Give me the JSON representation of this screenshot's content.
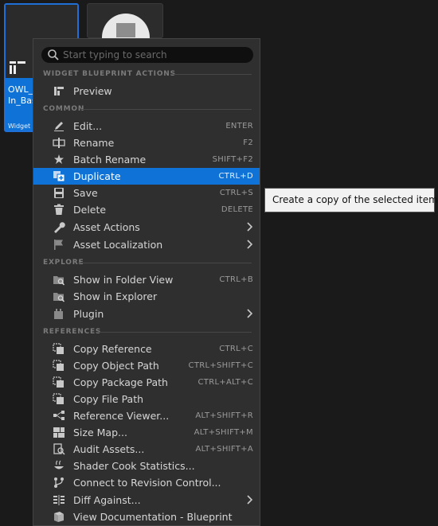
{
  "assets": [
    {
      "name_line1": "OWL_",
      "name_line2": "In_Bas",
      "type": "Widget B",
      "selected": true
    },
    {
      "name_line1": "",
      "name_line2": "",
      "type": "",
      "selected": false
    }
  ],
  "menu": {
    "search_placeholder": "Start typing to search",
    "sections": {
      "widget_actions": "WIDGET BLUEPRINT ACTIONS",
      "common": "COMMON",
      "explore": "EXPLORE",
      "references": "REFERENCES"
    },
    "items": [
      {
        "label": "Preview",
        "shortcut": "",
        "icon": "widget-blueprint-icon"
      },
      {
        "label": "Edit...",
        "shortcut": "ENTER",
        "icon": "pencil-icon"
      },
      {
        "label": "Rename",
        "shortcut": "F2",
        "icon": "rename-icon"
      },
      {
        "label": "Batch Rename",
        "shortcut": "SHIFT+F2",
        "icon": "batch-rename-icon"
      },
      {
        "label": "Duplicate",
        "shortcut": "CTRL+D",
        "icon": "duplicate-icon"
      },
      {
        "label": "Save",
        "shortcut": "CTRL+S",
        "icon": "save-icon"
      },
      {
        "label": "Delete",
        "shortcut": "DELETE",
        "icon": "trash-icon"
      },
      {
        "label": "Asset Actions",
        "shortcut": "",
        "icon": "wrench-icon"
      },
      {
        "label": "Asset Localization",
        "shortcut": "",
        "icon": "flag-icon"
      },
      {
        "label": "Show in Folder View",
        "shortcut": "CTRL+B",
        "icon": "folder-search-icon"
      },
      {
        "label": "Show in Explorer",
        "shortcut": "",
        "icon": "folder-icon"
      },
      {
        "label": "Plugin",
        "shortcut": "",
        "icon": "plugin-icon"
      },
      {
        "label": "Copy Reference",
        "shortcut": "CTRL+C",
        "icon": "copy-icon"
      },
      {
        "label": "Copy Object Path",
        "shortcut": "CTRL+SHIFT+C",
        "icon": "copy-icon"
      },
      {
        "label": "Copy Package Path",
        "shortcut": "CTRL+ALT+C",
        "icon": "copy-icon"
      },
      {
        "label": "Copy File Path",
        "shortcut": "",
        "icon": "copy-icon"
      },
      {
        "label": "Reference Viewer...",
        "shortcut": "ALT+SHIFT+R",
        "icon": "reference-viewer-icon"
      },
      {
        "label": "Size Map...",
        "shortcut": "ALT+SHIFT+M",
        "icon": "size-map-icon"
      },
      {
        "label": "Audit Assets...",
        "shortcut": "ALT+SHIFT+A",
        "icon": "audit-icon"
      },
      {
        "label": "Shader Cook Statistics...",
        "shortcut": "",
        "icon": "shader-icon"
      },
      {
        "label": "Connect to Revision Control...",
        "shortcut": "",
        "icon": "revision-control-icon"
      },
      {
        "label": "Diff Against...",
        "shortcut": "",
        "icon": "diff-icon"
      },
      {
        "label": "View Documentation - Blueprint",
        "shortcut": "",
        "icon": "documentation-icon"
      }
    ]
  },
  "tooltip": {
    "text": "Create a copy of the selected item(s)."
  },
  "colors": {
    "accent": "#0e72d6",
    "menu_bg": "#2f2f2f",
    "tooltip_bg": "#f2f2f2"
  }
}
